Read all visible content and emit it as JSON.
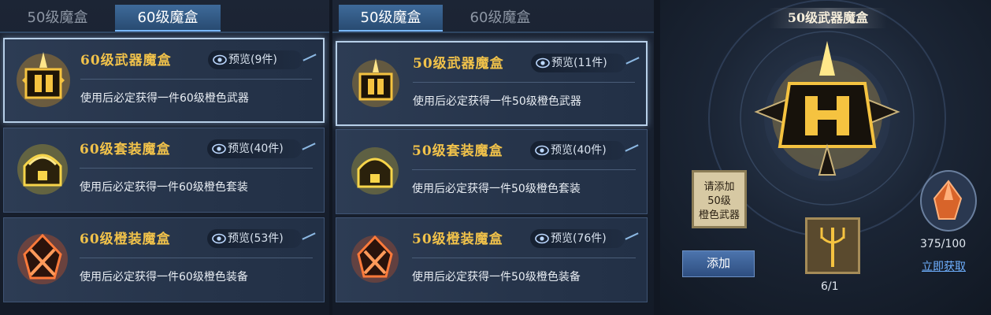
{
  "left_panel": {
    "tabs": [
      "50级魔盒",
      "60级魔盒"
    ],
    "cards": [
      {
        "title": "60级武器魔盒",
        "preview": "预览(9件)",
        "desc": "使用后必定获得一件60级橙色武器",
        "icon": "weapon-chest-icon"
      },
      {
        "title": "60级套装魔盒",
        "preview": "预览(40件)",
        "desc": "使用后必定获得一件60级橙色套装",
        "icon": "set-chest-icon"
      },
      {
        "title": "60级橙装魔盒",
        "preview": "预览(53件)",
        "desc": "使用后必定获得一件60级橙色装备",
        "icon": "orange-gear-chest-icon"
      }
    ]
  },
  "mid_panel": {
    "tabs": [
      "50级魔盒",
      "60级魔盒"
    ],
    "cards": [
      {
        "title": "50级武器魔盒",
        "preview": "预览(11件)",
        "desc": "使用后必定获得一件50级橙色武器",
        "icon": "weapon-chest-icon"
      },
      {
        "title": "50级套装魔盒",
        "preview": "预览(40件)",
        "desc": "使用后必定获得一件50级橙色套装",
        "icon": "set-chest-icon"
      },
      {
        "title": "50级橙装魔盒",
        "preview": "预览(76件)",
        "desc": "使用后必定获得一件50级橙色装备",
        "icon": "orange-gear-chest-icon"
      }
    ]
  },
  "right_panel": {
    "title": "50级武器魔盒",
    "add_slot_lines": [
      "请添加",
      "50级",
      "橙色武器"
    ],
    "add_button": "添加",
    "weapon_count": "6/1",
    "material_count": "375/100",
    "get_now_link": "立即获取"
  }
}
